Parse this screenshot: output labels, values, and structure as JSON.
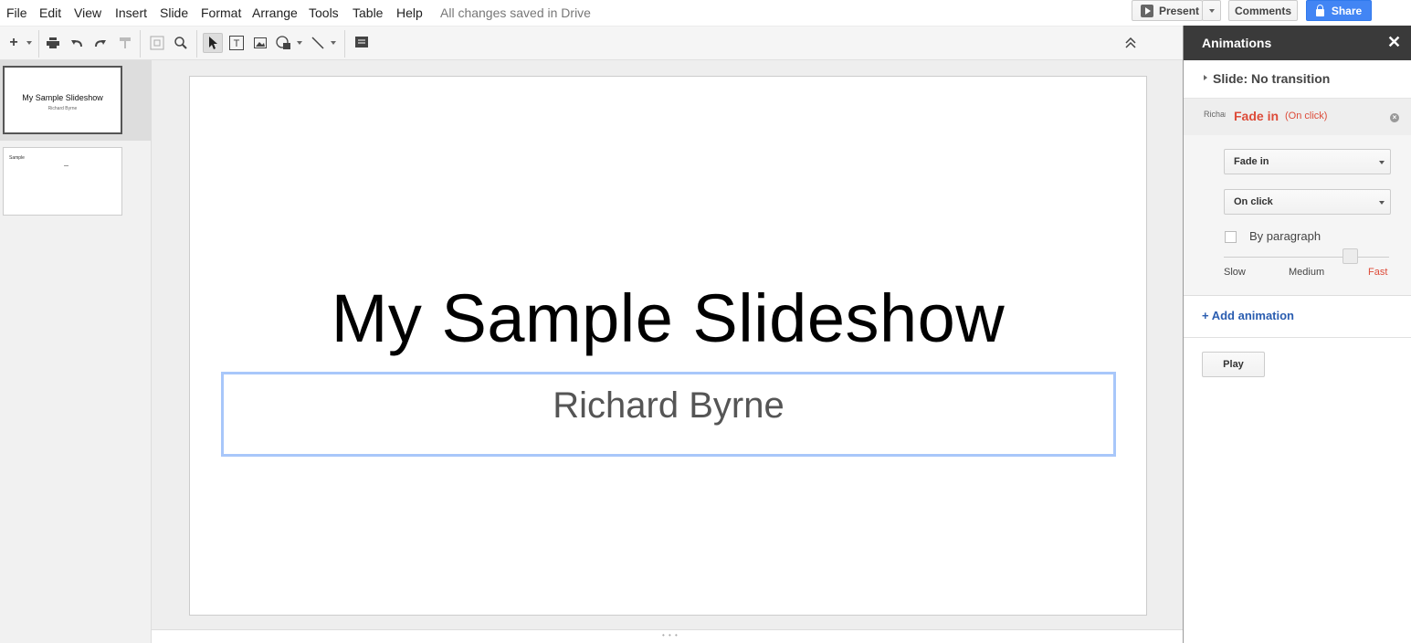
{
  "menu": [
    "File",
    "Edit",
    "View",
    "Insert",
    "Slide",
    "Format",
    "Arrange",
    "Tools",
    "Table",
    "Help"
  ],
  "save_status": "All changes saved in Drive",
  "top_buttons": {
    "present": "Present",
    "comments": "Comments",
    "share": "Share"
  },
  "toolbar_icons": [
    "new-slide-icon",
    "print-icon",
    "undo-icon",
    "redo-icon",
    "paint-format-icon",
    "zoom-fit-icon",
    "zoom-icon",
    "select-icon",
    "text-box-icon",
    "image-icon",
    "shape-icon",
    "line-icon",
    "comment-icon",
    "collapse-icon"
  ],
  "filmstrip": {
    "slide1": {
      "title": "My Sample Slideshow",
      "subtitle": "Richard Byrne"
    },
    "slide2": {
      "title": "Sample"
    }
  },
  "slide": {
    "title": "My Sample Slideshow",
    "subtitle": "Richard Byrne"
  },
  "animations_panel": {
    "title": "Animations",
    "close": "✕",
    "transition": "Slide: No transition",
    "item": {
      "target": "Richard Byrne",
      "effect": "Fade in",
      "trigger": "(On click)",
      "effect_select": "Fade in",
      "trigger_select": "On click",
      "by_paragraph_label": "By paragraph",
      "by_paragraph_checked": false,
      "speed_labels": {
        "slow": "Slow",
        "medium": "Medium",
        "fast": "Fast"
      },
      "speed": "Fast"
    },
    "add_animation": "+ Add animation",
    "play": "Play"
  },
  "colors": {
    "accent_red": "#dd4b39",
    "share_blue": "#4285f4",
    "link_blue": "#2a5db0",
    "selection_blue": "#a8c7fa"
  }
}
